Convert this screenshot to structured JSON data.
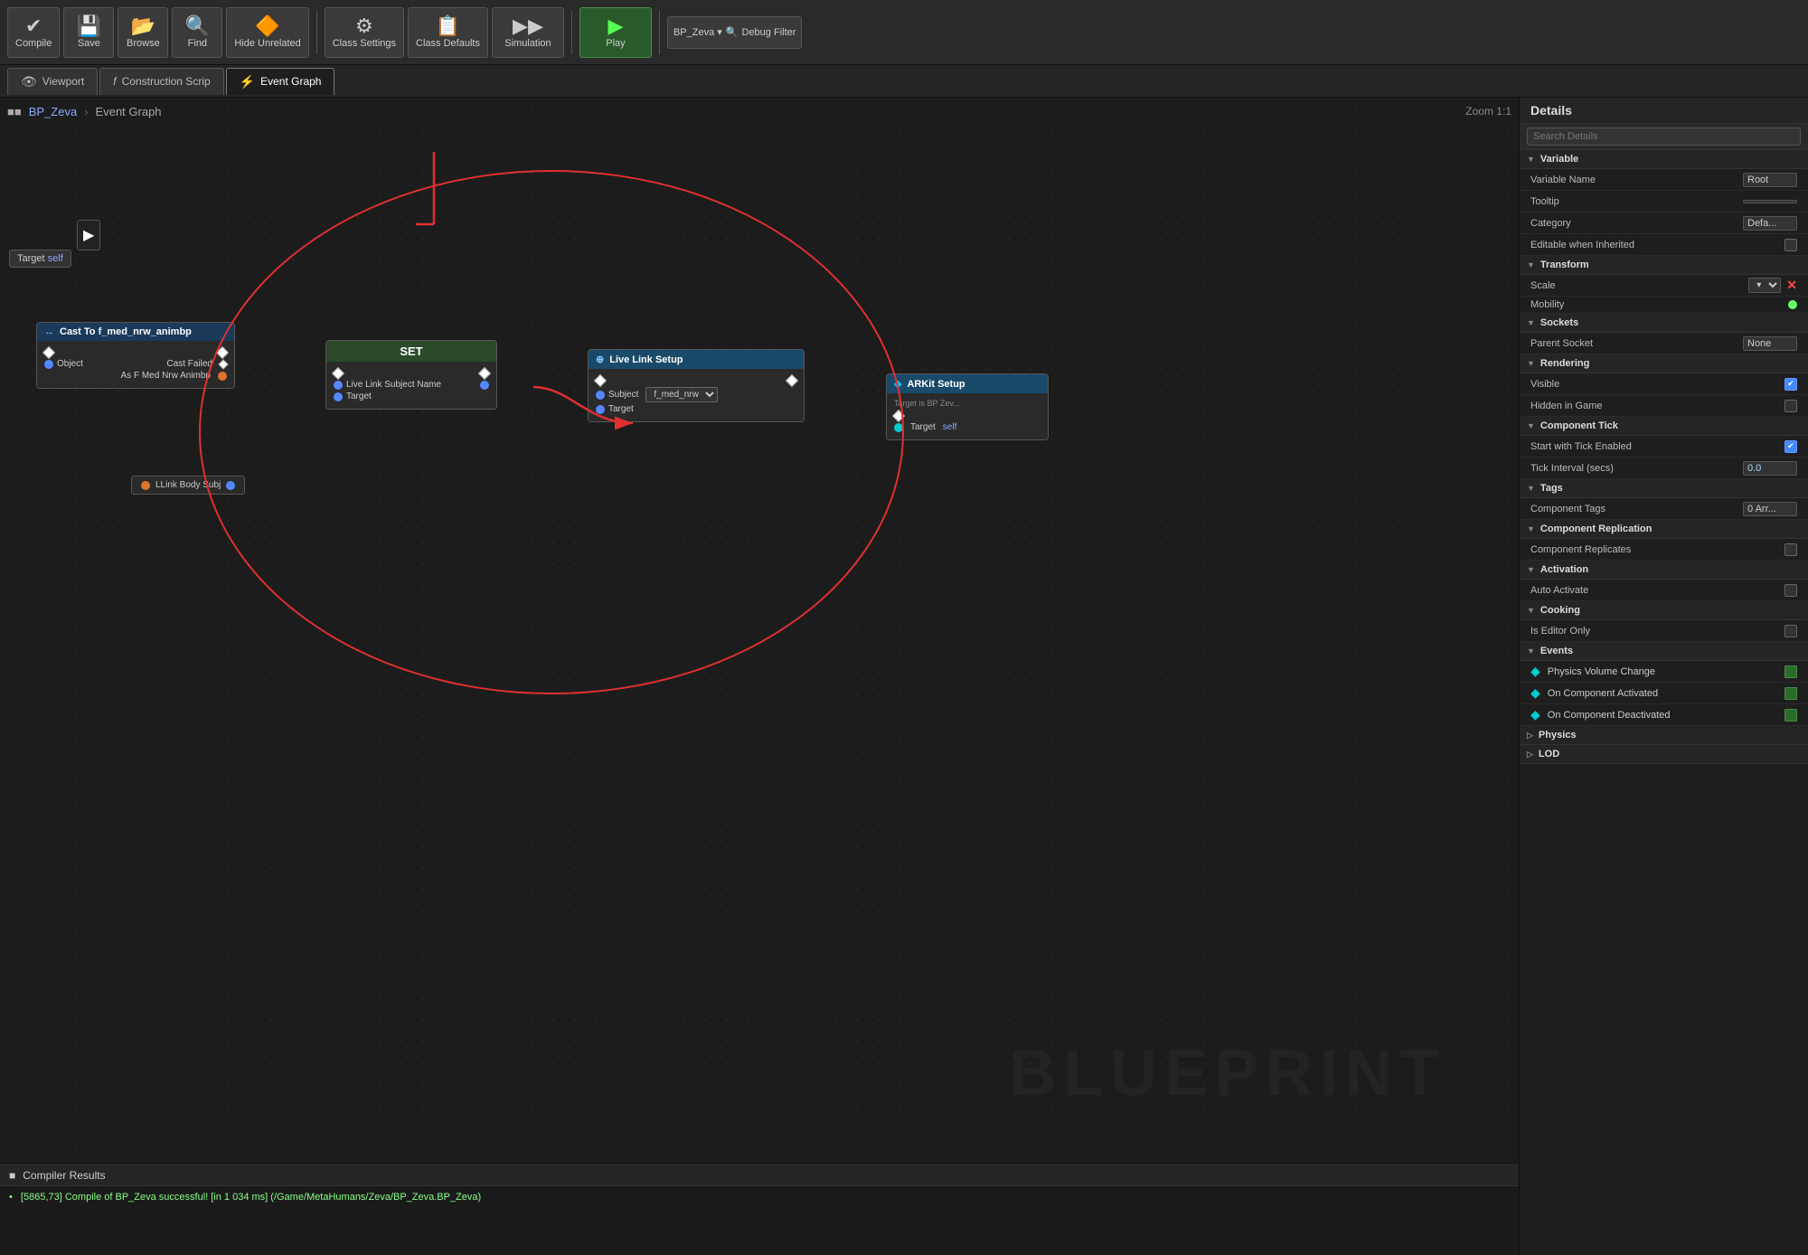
{
  "toolbar": {
    "compile_label": "Compile",
    "save_label": "Save",
    "browse_label": "Browse",
    "find_label": "Find",
    "hide_unrelated_label": "Hide Unrelated",
    "class_settings_label": "Class Settings",
    "class_defaults_label": "Class Defaults",
    "simulation_label": "Simulation",
    "play_label": "Play",
    "debug_filter_label": "Debug Filter",
    "bp_zeva_label": "BP_Zeva ▾"
  },
  "tabs": [
    {
      "id": "viewport",
      "label": "Viewport",
      "icon": "👁",
      "active": false
    },
    {
      "id": "construction",
      "label": "Construction Scrip",
      "icon": "f",
      "active": false
    },
    {
      "id": "event_graph",
      "label": "Event Graph",
      "icon": "⚡",
      "active": true
    }
  ],
  "canvas": {
    "breadcrumb": "BP_Zeva",
    "graph_name": "Event Graph",
    "zoom": "Zoom 1:1",
    "watermark": "BLUEPRINT"
  },
  "nodes": {
    "cast_node": {
      "title": "Cast To f_med_nrw_animbp",
      "header_color": "#1a3a5a",
      "object_pin": "Object",
      "cast_failed": "Cast Failed",
      "output_pin": "As F Med Nrw Animbp"
    },
    "set_node": {
      "title": "SET",
      "header_color": "#2a4a2a",
      "pin1": "Live Link Subject Name",
      "pin2": "Target"
    },
    "live_link_node": {
      "title": "Live Link Setup",
      "header_color": "#1a4a6a",
      "subject_label": "Subject",
      "subject_value": "f_med_nrw",
      "target_label": "Target"
    },
    "arkit_node": {
      "title": "ARKit Setup",
      "subtitle": "Target is BP Zev...",
      "header_color": "#1a4a6a"
    },
    "llink_body": {
      "label": "LLink Body Subj"
    }
  },
  "compiler": {
    "title": "Compiler Results",
    "message": "[5865,73] Compile of BP_Zeva successful! [in 1 034 ms] (/Game/MetaHumans/Zeva/BP_Zeva.BP_Zeva)"
  },
  "details": {
    "title": "Details",
    "search_placeholder": "Search Details",
    "sections": {
      "variable": {
        "label": "Variable",
        "variable_name_label": "Variable Name",
        "variable_name_value": "Root",
        "tooltip_label": "Tooltip",
        "category_label": "Category",
        "category_value": "Defa...",
        "editable_label": "Editable when Inherited"
      },
      "transform": {
        "label": "Transform",
        "scale_label": "Scale",
        "mobility_label": "Mobility"
      },
      "sockets": {
        "label": "Sockets",
        "parent_socket_label": "Parent Socket",
        "parent_socket_value": "None"
      },
      "rendering": {
        "label": "Rendering",
        "visible_label": "Visible",
        "hidden_label": "Hidden in Game"
      },
      "component_tick": {
        "label": "Component Tick",
        "start_label": "Start with Tick Enabled",
        "interval_label": "Tick Interval (secs)",
        "interval_value": "0.0"
      },
      "tags": {
        "label": "Tags",
        "component_tags_label": "Component Tags",
        "component_tags_value": "0 Arr..."
      },
      "component_replication": {
        "label": "Component Replication",
        "replicates_label": "Component Replicates"
      },
      "activation": {
        "label": "Activation",
        "auto_activate_label": "Auto Activate"
      },
      "cooking": {
        "label": "Cooking",
        "is_editor_only_label": "Is Editor Only"
      },
      "events": {
        "label": "Events",
        "physics_volume_change": "Physics Volume Change",
        "on_component_activated": "On Component Activated",
        "on_component_deactivated": "On Component Deactivated"
      },
      "physics": {
        "label": "Physics"
      },
      "lod": {
        "label": "LOD"
      }
    }
  }
}
